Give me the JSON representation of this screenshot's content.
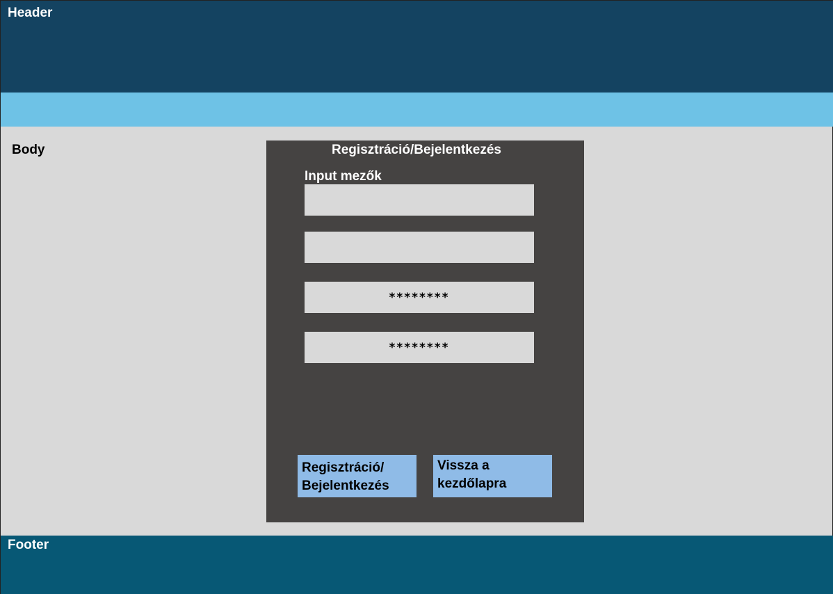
{
  "header": {
    "label": "Header"
  },
  "body": {
    "label": "Body"
  },
  "panel": {
    "title": "Regisztráció/Bejelentkezés",
    "inputs_label": "Input mezők",
    "fields": [
      {
        "value": ""
      },
      {
        "value": ""
      },
      {
        "value": "********"
      },
      {
        "value": "********"
      }
    ],
    "register_button": "Regisztráció/\nBejelentkezés",
    "back_button": "Vissza a\nkezdőlapra"
  },
  "footer": {
    "label": "Footer"
  },
  "colors": {
    "header": "#144361",
    "nav_strip": "#6ec2e6",
    "body": "#d9d9d9",
    "panel": "#454342",
    "button": "#8fbbe7",
    "footer": "#075875"
  }
}
